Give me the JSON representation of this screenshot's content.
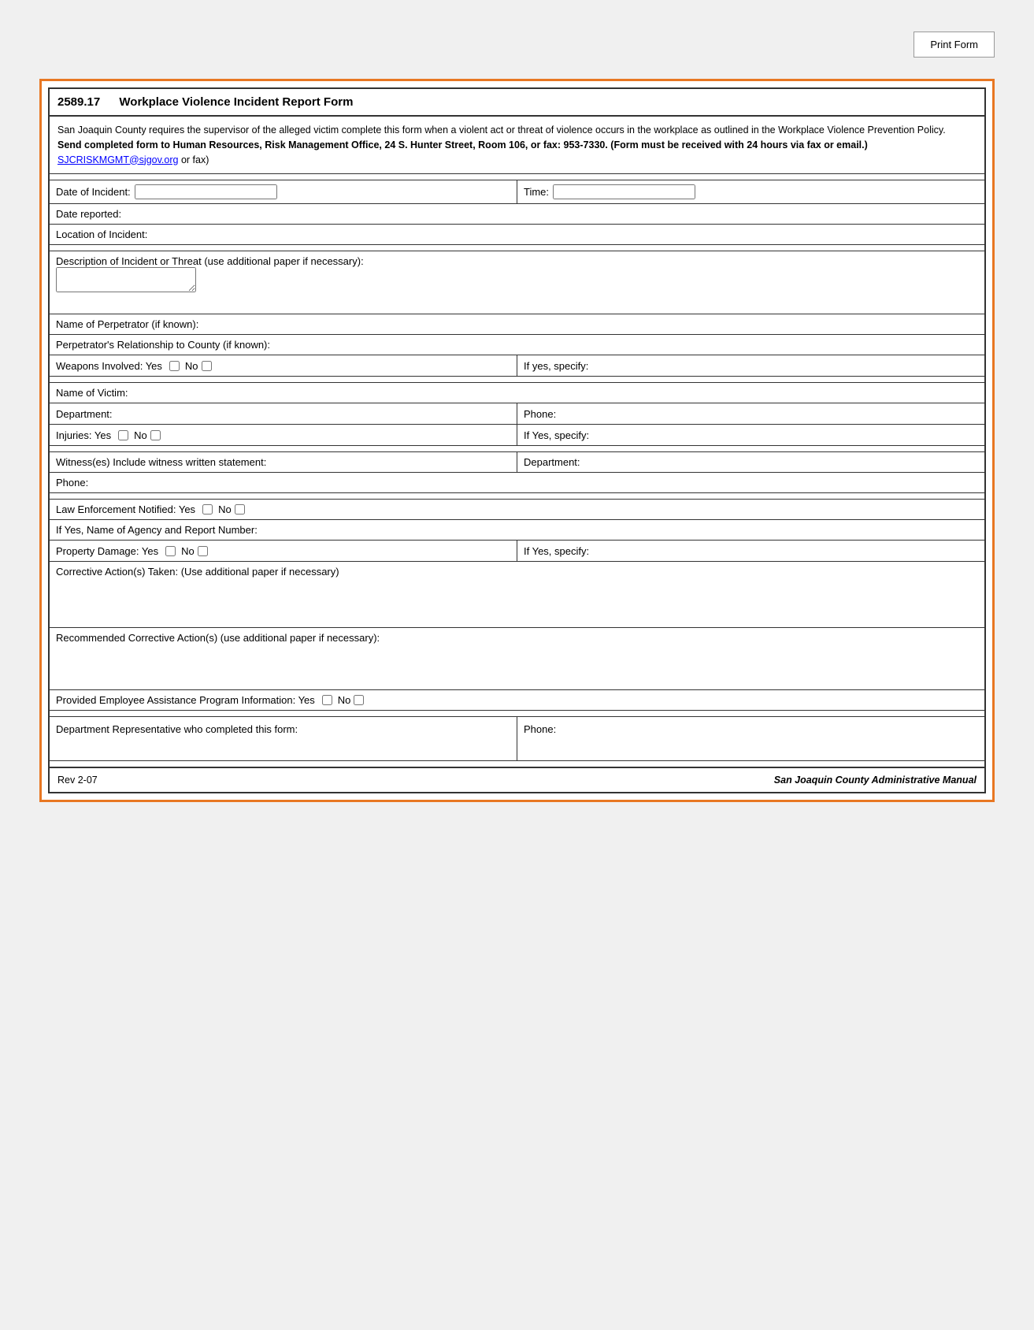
{
  "page": {
    "title": "Workplace Violence Incident Report Form",
    "form_number": "2589.17",
    "print_button": "Print Form",
    "intro": {
      "line1": "San Joaquin County requires the supervisor of the alleged victim complete this form when a violent act or threat of violence occurs in the workplace as outlined in the Workplace Violence Prevention Policy.",
      "bold_line": "Send completed form to Human Resources, Risk Management Office, 24 S. Hunter Street, Room 106, or fax:  953-7330.  (Form must be received with 24 hours via fax or email.)",
      "email": "SJCRISKMGMT@sjgov.org",
      "email_suffix": " or fax)"
    },
    "fields": {
      "date_of_incident_label": "Date of Incident:",
      "time_label": "Time:",
      "date_reported_label": "Date reported:",
      "location_label": "Location of Incident:",
      "description_label": "Description of Incident or Threat (use additional paper if necessary):",
      "perpetrator_name_label": "Name of Perpetrator (if known):",
      "perpetrator_relationship_label": "Perpetrator's Relationship to County (if known):",
      "weapons_label": "Weapons Involved: Yes",
      "weapons_no_label": "No",
      "weapons_specify_label": "If yes, specify:",
      "victim_name_label": "Name of Victim:",
      "department_label": "Department:",
      "phone_label": "Phone:",
      "injuries_label": "Injuries: Yes",
      "injuries_no_label": "No",
      "injuries_specify_label": "If Yes, specify:",
      "witness_label": "Witness(es) Include witness written statement:",
      "witness_dept_label": "Department:",
      "witness_phone_label": "Phone:",
      "law_enforcement_label": "Law Enforcement Notified: Yes",
      "law_enforcement_no_label": "No",
      "agency_report_label": "If Yes, Name of Agency and Report Number:",
      "property_damage_label": "Property Damage: Yes",
      "property_damage_no_label": "No",
      "property_damage_specify_label": "If Yes, specify:",
      "corrective_action_label": "Corrective Action(s) Taken: (Use additional paper if necessary)",
      "recommended_action_label": "Recommended Corrective Action(s) (use additional paper if necessary):",
      "eap_label": "Provided Employee Assistance Program Information:   Yes",
      "eap_no_label": "No",
      "dept_rep_label": "Department Representative who completed this form:",
      "dept_rep_phone_label": "Phone:"
    },
    "footer": {
      "rev": "Rev 2-07",
      "manual": "San Joaquin County Administrative Manual"
    }
  }
}
